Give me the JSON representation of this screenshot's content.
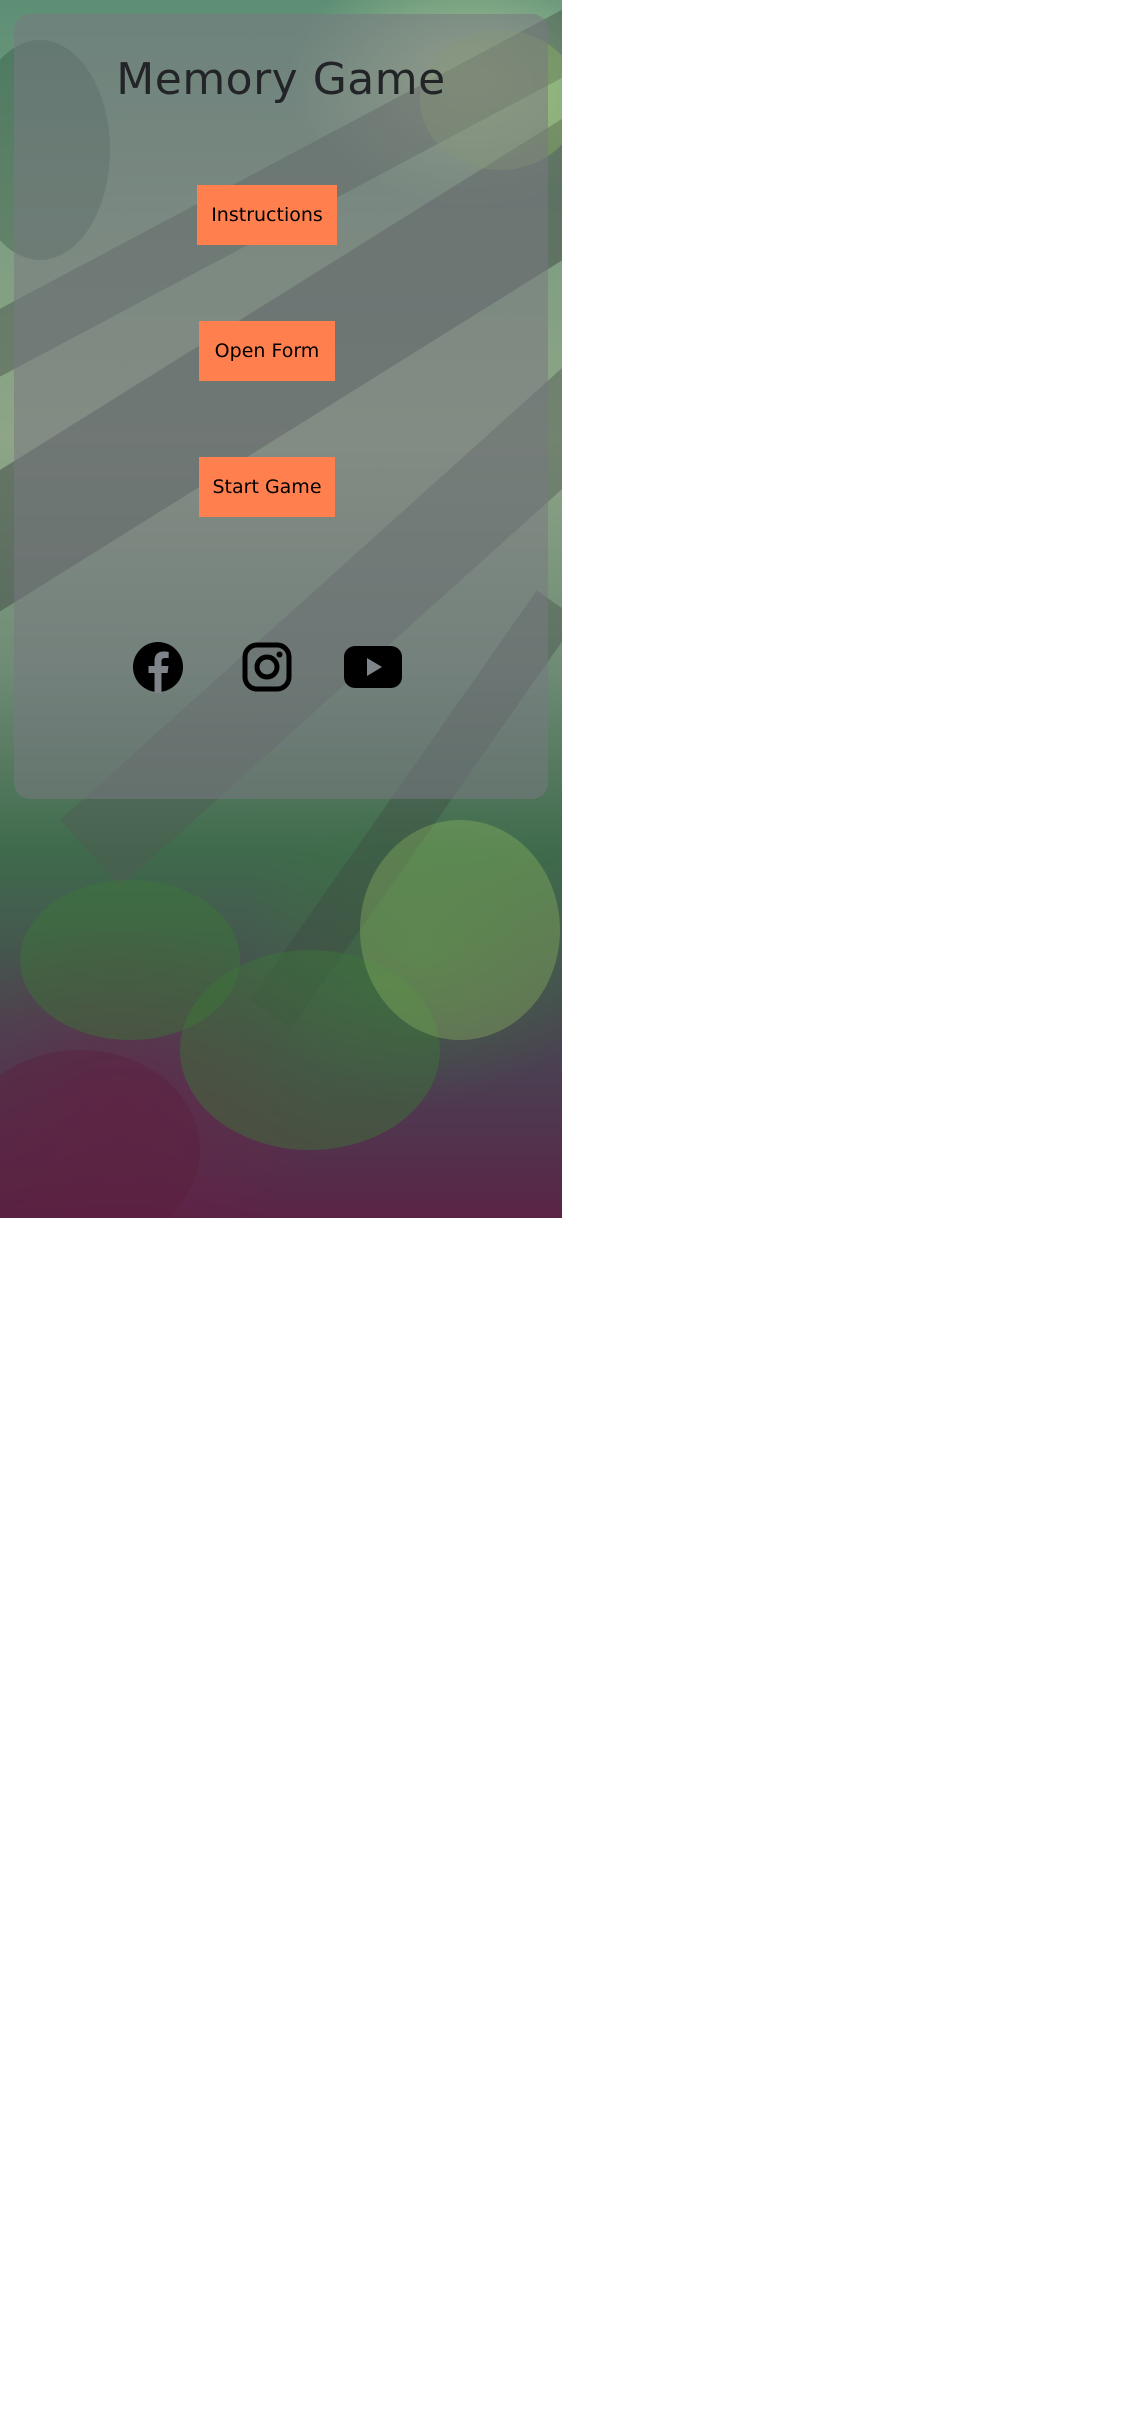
{
  "title": "Memory Game",
  "buttons": {
    "instructions_label": "Instructions",
    "open_form_label": "Open Form",
    "start_game_label": "Start Game"
  },
  "social": [
    {
      "name": "facebook",
      "icon": "facebook-icon"
    },
    {
      "name": "instagram",
      "icon": "instagram-icon"
    },
    {
      "name": "youtube",
      "icon": "youtube-icon"
    }
  ],
  "colors": {
    "button_bg": "#ff7f4f",
    "title_text": "#222428",
    "card_overlay": "rgba(120,120,130,0.55)"
  }
}
